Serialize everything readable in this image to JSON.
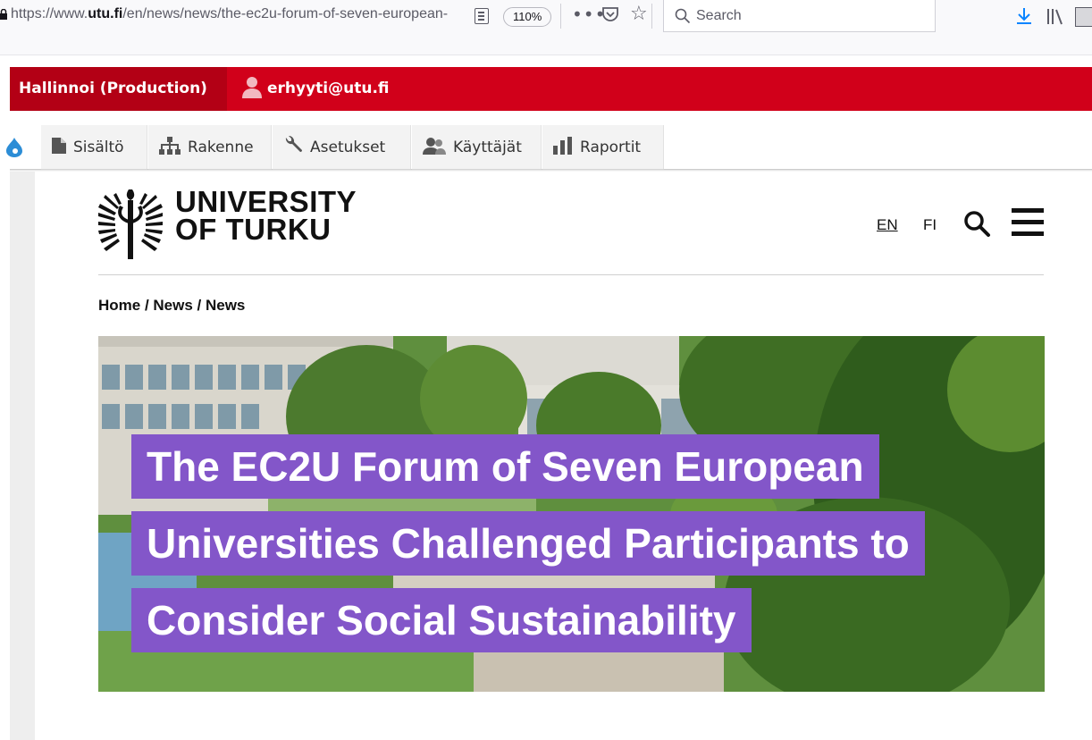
{
  "browser": {
    "url_prefix": "https://www.",
    "url_domain": "utu.fi",
    "url_rest": "/en/news/news/the-ec2u-forum-of-seven-european-",
    "zoom": "110%",
    "more": "•••",
    "search_placeholder": "Search",
    "icons": [
      "lock-icon",
      "reader-view-icon",
      "pocket-icon",
      "bookmark-star-icon",
      "search-icon",
      "download-icon",
      "library-icon",
      "sidebar-icon"
    ]
  },
  "admin": {
    "manage_label": "Hallinnoi (Production)",
    "user_label": "erhyyti@utu.fi",
    "tray": [
      {
        "label": "Sisältö",
        "icon": "file-icon"
      },
      {
        "label": "Rakenne",
        "icon": "sitemap-icon"
      },
      {
        "label": "Asetukset",
        "icon": "wrench-icon"
      },
      {
        "label": "Käyttäjät",
        "icon": "people-icon"
      },
      {
        "label": "Raportit",
        "icon": "bar-chart-icon"
      }
    ],
    "colors": {
      "bar": "#d1001a",
      "manage": "#b30015"
    }
  },
  "site": {
    "logo_line1": "UNIVERSITY",
    "logo_line2": "OF TURKU",
    "lang_en": "EN",
    "lang_fi": "FI",
    "breadcrumb": "Home / News / News"
  },
  "hero": {
    "title_lines": [
      "The EC2U Forum of Seven European",
      "Universities Challenged Participants to",
      "Consider Social Sustainability"
    ],
    "title_bg": "#8356c9"
  }
}
